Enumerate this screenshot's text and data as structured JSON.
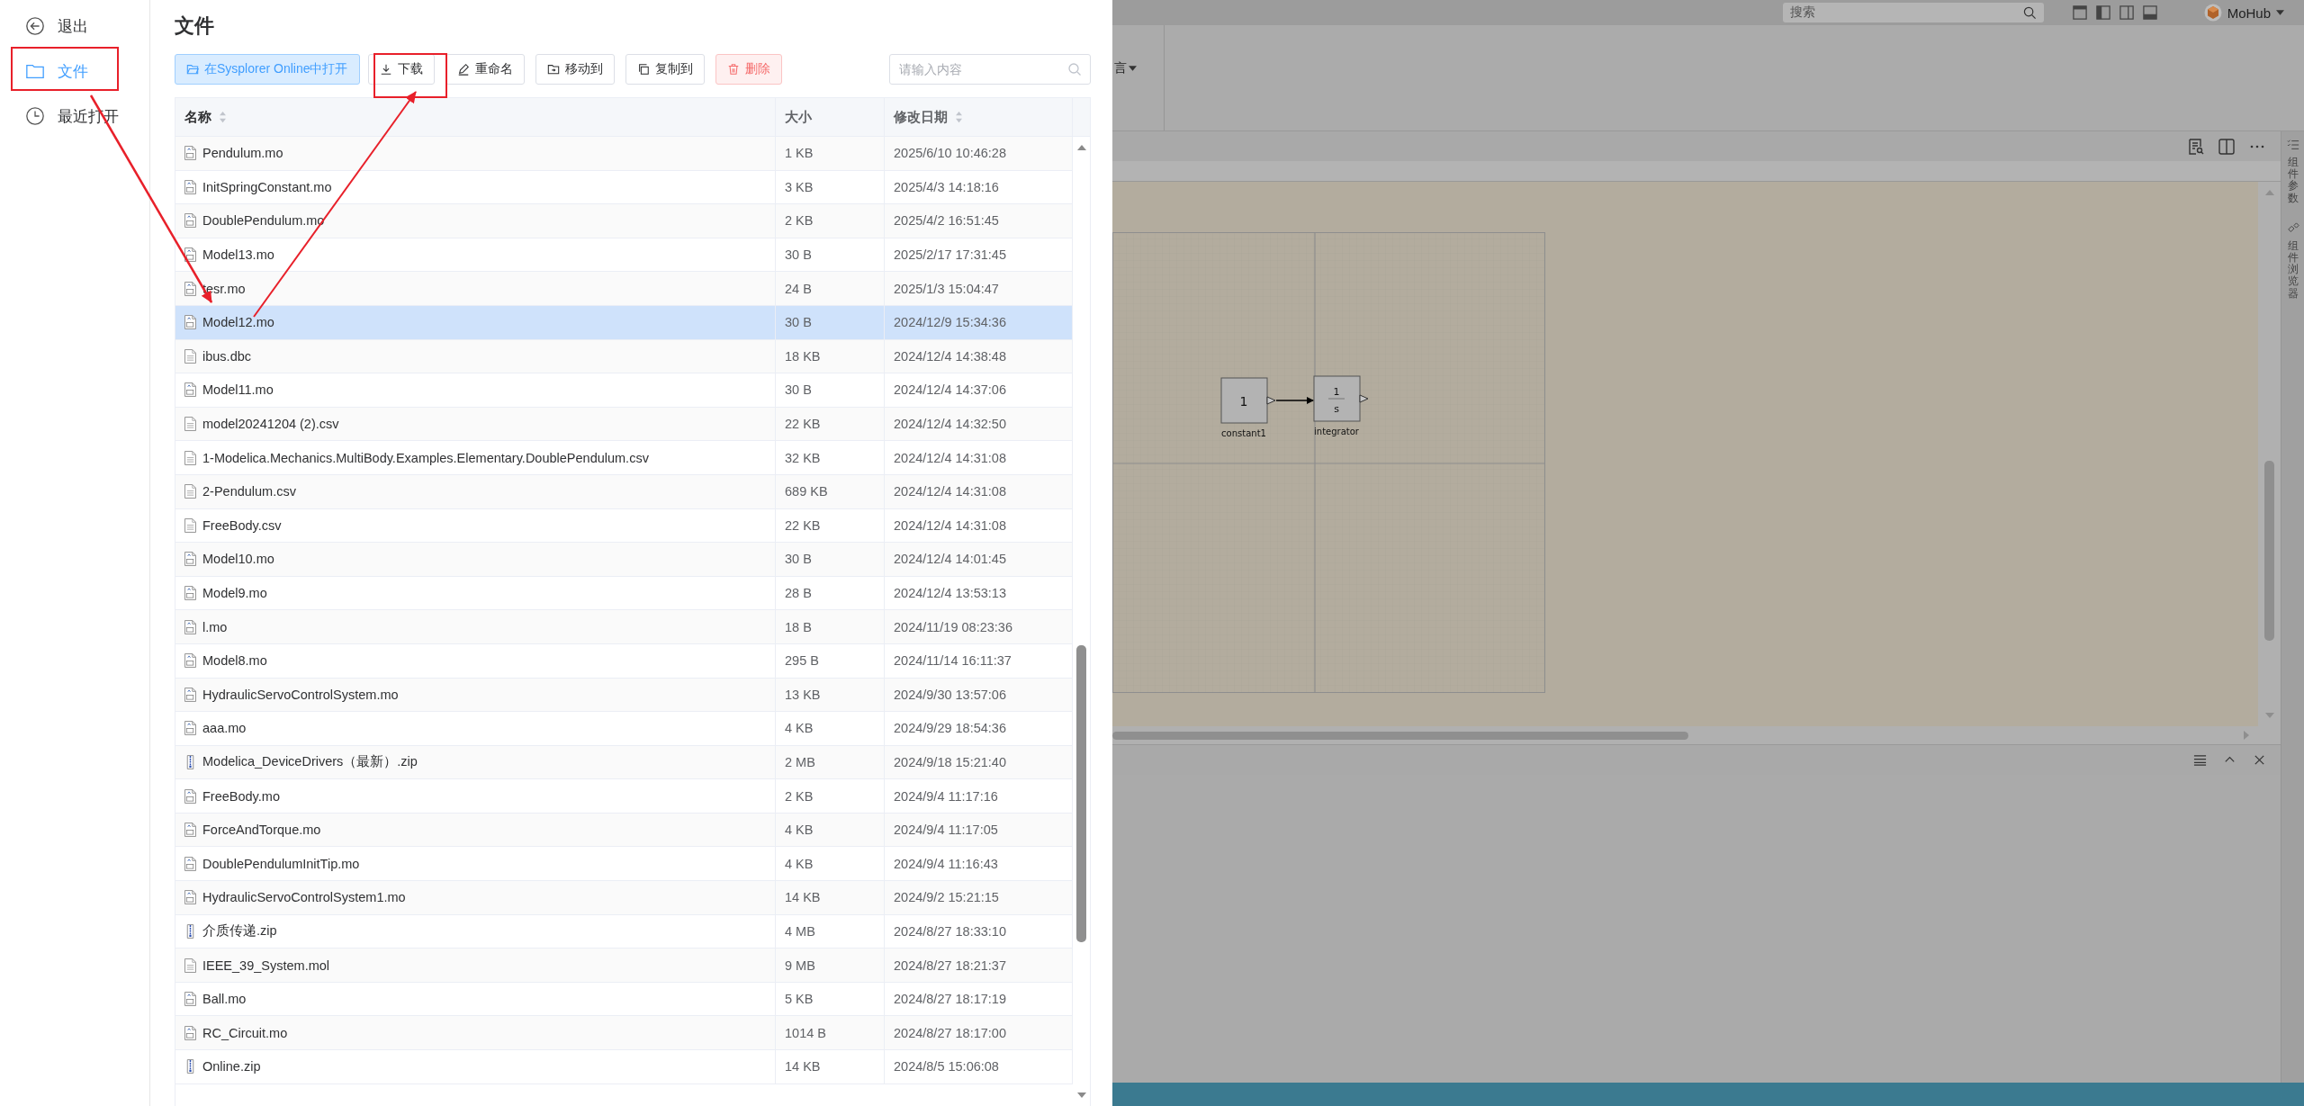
{
  "sidebar": {
    "items": [
      {
        "label": "退出",
        "kind": "exit",
        "selected": false
      },
      {
        "label": "文件",
        "kind": "files",
        "selected": true
      },
      {
        "label": "最近打开",
        "kind": "recent",
        "selected": false
      }
    ]
  },
  "page": {
    "title": "文件"
  },
  "toolbar": {
    "buttons": [
      {
        "label": "在Sysplorer Online中打开",
        "kind": "open"
      },
      {
        "label": "下载",
        "kind": "download"
      },
      {
        "label": "重命名",
        "kind": "rename"
      },
      {
        "label": "移动到",
        "kind": "move"
      },
      {
        "label": "复制到",
        "kind": "copy"
      },
      {
        "label": "删除",
        "kind": "delete"
      }
    ],
    "search": {
      "placeholder": "请输入内容"
    }
  },
  "table": {
    "columns": [
      {
        "label": "名称",
        "sortable": true
      },
      {
        "label": "大小",
        "sortable": false
      },
      {
        "label": "修改日期",
        "sortable": true
      }
    ],
    "rows": [
      {
        "name": "Pendulum.mo",
        "kind": "mo",
        "size": "1 KB",
        "modified": "2025/6/10 10:46:28",
        "selected": false
      },
      {
        "name": "InitSpringConstant.mo",
        "kind": "mo",
        "size": "3 KB",
        "modified": "2025/4/3 14:18:16",
        "selected": false
      },
      {
        "name": "DoublePendulum.mo",
        "kind": "mo",
        "size": "2 KB",
        "modified": "2025/4/2 16:51:45",
        "selected": false
      },
      {
        "name": "Model13.mo",
        "kind": "mo",
        "size": "30 B",
        "modified": "2025/2/17 17:31:45",
        "selected": false
      },
      {
        "name": "tesr.mo",
        "kind": "mo",
        "size": "24 B",
        "modified": "2025/1/3 15:04:47",
        "selected": false
      },
      {
        "name": "Model12.mo",
        "kind": "mo",
        "size": "30 B",
        "modified": "2024/12/9 15:34:36",
        "selected": true
      },
      {
        "name": "ibus.dbc",
        "kind": "doc",
        "size": "18 KB",
        "modified": "2024/12/4 14:38:48",
        "selected": false
      },
      {
        "name": "Model11.mo",
        "kind": "mo",
        "size": "30 B",
        "modified": "2024/12/4 14:37:06",
        "selected": false
      },
      {
        "name": "model20241204 (2).csv",
        "kind": "doc",
        "size": "22 KB",
        "modified": "2024/12/4 14:32:50",
        "selected": false
      },
      {
        "name": "1-Modelica.Mechanics.MultiBody.Examples.Elementary.DoublePendulum.csv",
        "kind": "doc",
        "size": "32 KB",
        "modified": "2024/12/4 14:31:08",
        "selected": false
      },
      {
        "name": "2-Pendulum.csv",
        "kind": "doc",
        "size": "689 KB",
        "modified": "2024/12/4 14:31:08",
        "selected": false
      },
      {
        "name": "FreeBody.csv",
        "kind": "doc",
        "size": "22 KB",
        "modified": "2024/12/4 14:31:08",
        "selected": false
      },
      {
        "name": "Model10.mo",
        "kind": "mo",
        "size": "30 B",
        "modified": "2024/12/4 14:01:45",
        "selected": false
      },
      {
        "name": "Model9.mo",
        "kind": "mo",
        "size": "28 B",
        "modified": "2024/12/4 13:53:13",
        "selected": false
      },
      {
        "name": "l.mo",
        "kind": "mo",
        "size": "18 B",
        "modified": "2024/11/19 08:23:36",
        "selected": false
      },
      {
        "name": "Model8.mo",
        "kind": "mo",
        "size": "295 B",
        "modified": "2024/11/14 16:11:37",
        "selected": false
      },
      {
        "name": "HydraulicServoControlSystem.mo",
        "kind": "mo",
        "size": "13 KB",
        "modified": "2024/9/30 13:57:06",
        "selected": false
      },
      {
        "name": "aaa.mo",
        "kind": "mo",
        "size": "4 KB",
        "modified": "2024/9/29 18:54:36",
        "selected": false
      },
      {
        "name": "Modelica_DeviceDrivers（最新）.zip",
        "kind": "zip",
        "size": "2 MB",
        "modified": "2024/9/18 15:21:40",
        "selected": false
      },
      {
        "name": "FreeBody.mo",
        "kind": "mo",
        "size": "2 KB",
        "modified": "2024/9/4 11:17:16",
        "selected": false
      },
      {
        "name": "ForceAndTorque.mo",
        "kind": "mo",
        "size": "4 KB",
        "modified": "2024/9/4 11:17:05",
        "selected": false
      },
      {
        "name": "DoublePendulumInitTip.mo",
        "kind": "mo",
        "size": "4 KB",
        "modified": "2024/9/4 11:16:43",
        "selected": false
      },
      {
        "name": "HydraulicServoControlSystem1.mo",
        "kind": "mo",
        "size": "14 KB",
        "modified": "2024/9/2 15:21:15",
        "selected": false
      },
      {
        "name": "介质传递.zip",
        "kind": "zip",
        "size": "4 MB",
        "modified": "2024/8/27 18:33:10",
        "selected": false
      },
      {
        "name": "IEEE_39_System.mol",
        "kind": "doc",
        "size": "9 MB",
        "modified": "2024/8/27 18:21:37",
        "selected": false
      },
      {
        "name": "Ball.mo",
        "kind": "mo",
        "size": "5 KB",
        "modified": "2024/8/27 18:17:19",
        "selected": false
      },
      {
        "name": "RC_Circuit.mo",
        "kind": "mo",
        "size": "1014 B",
        "modified": "2024/8/27 18:17:00",
        "selected": false
      },
      {
        "name": "Online.zip",
        "kind": "zip",
        "size": "14 KB",
        "modified": "2024/8/5 15:06:08",
        "selected": false
      }
    ]
  },
  "background_app": {
    "search": {
      "placeholder": "搜索"
    },
    "user": "MoHub",
    "ribbon_label": "言",
    "side_tabs": [
      "组件参数",
      "组件浏览器"
    ],
    "diagram": {
      "blocks": [
        {
          "kind": "constant",
          "label": "constant1",
          "value": "1"
        },
        {
          "kind": "integrator",
          "label": "integrator",
          "numerator": "1",
          "denominator": "s"
        }
      ]
    }
  }
}
